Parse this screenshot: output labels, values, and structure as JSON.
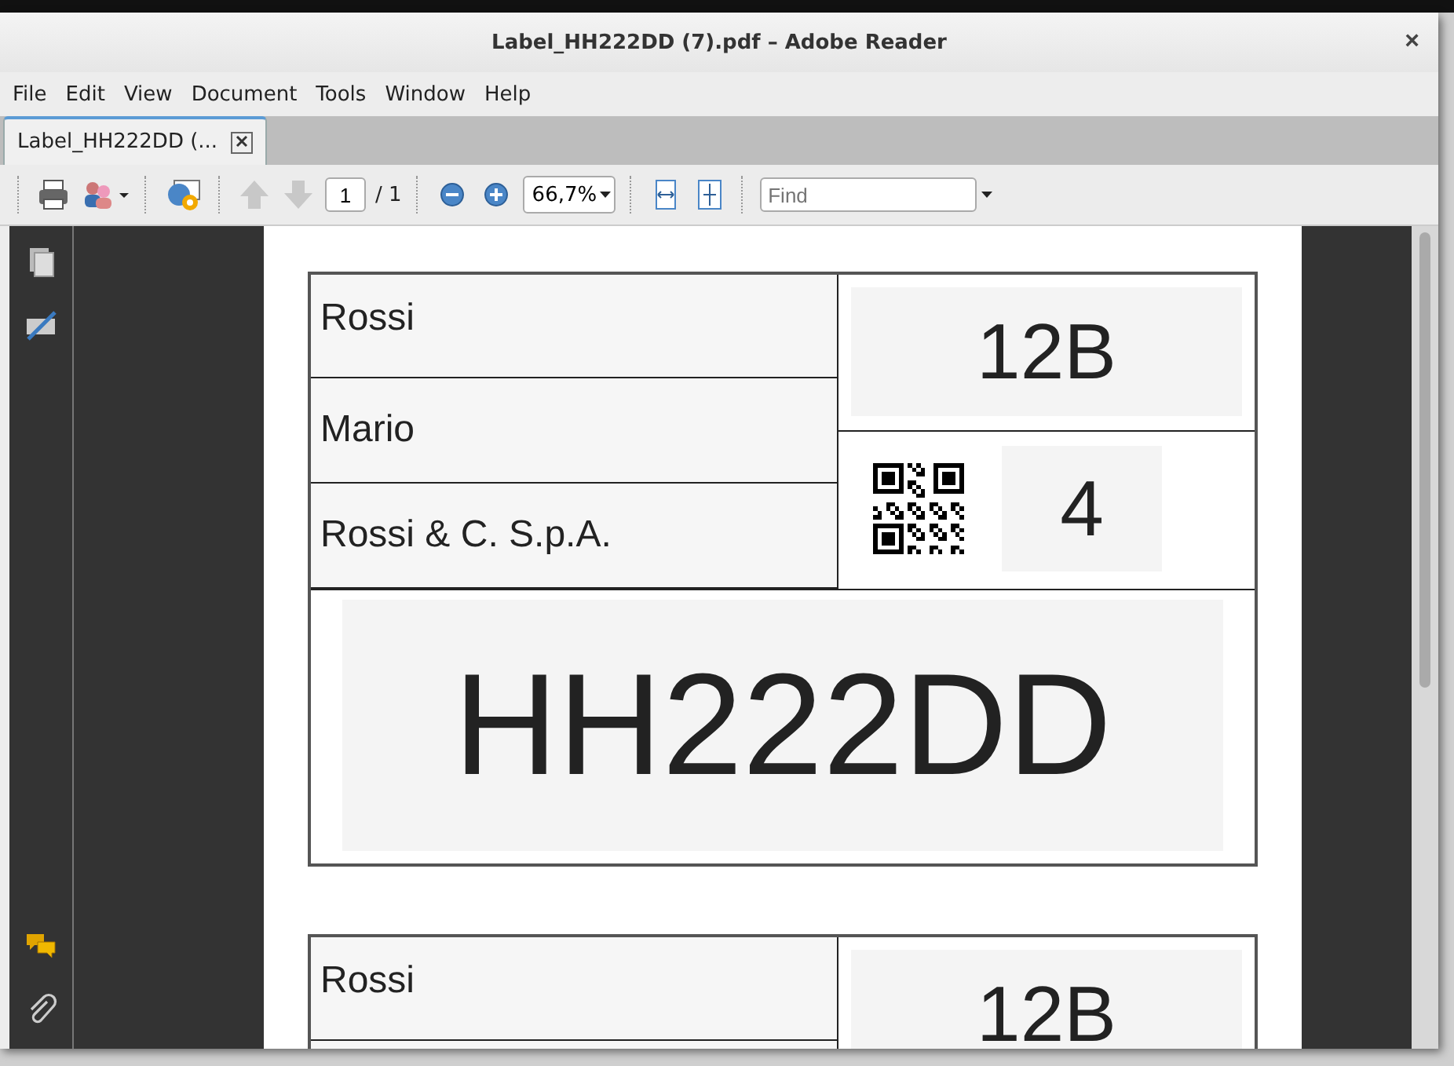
{
  "window": {
    "title": "Label_HH222DD (7).pdf – Adobe Reader",
    "close": "×"
  },
  "menu": [
    "File",
    "Edit",
    "View",
    "Document",
    "Tools",
    "Window",
    "Help"
  ],
  "tabs": [
    {
      "label": "Label_HH222DD (...",
      "selected": true
    }
  ],
  "toolbar": {
    "page": "1",
    "page_total": "/ 1",
    "zoom": "66,7%",
    "find": {
      "placeholder": "Find"
    },
    "prev_disabled": true,
    "next_disabled": true
  },
  "labels": [
    {
      "surname": "Rossi",
      "name": "Mario",
      "company": "Rossi & C. S.p.A.",
      "code": "12B",
      "count": "4",
      "plate": "HH222DD"
    },
    {
      "surname": "Rossi",
      "code": "12B"
    }
  ]
}
